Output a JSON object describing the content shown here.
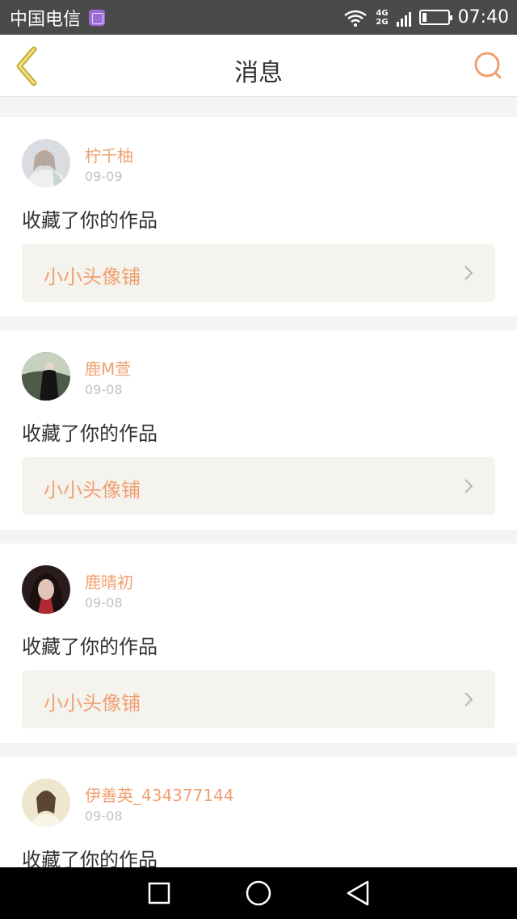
{
  "status_bar": {
    "carrier": "中国电信",
    "network_top": "4G",
    "network_bottom": "2G",
    "time": "07:40",
    "icons": [
      "photo-icon",
      "wifi-icon",
      "signal-icon",
      "battery-icon"
    ]
  },
  "header": {
    "title": "消息",
    "back_icon": "chevron-left-icon",
    "search_icon": "search-icon",
    "accent_color": "#f0a070"
  },
  "messages": [
    {
      "username": "柠千柚",
      "date": "09-09",
      "action": "收藏了你的作品",
      "work": "小小头像铺"
    },
    {
      "username": "鹿M萱",
      "date": "09-08",
      "action": "收藏了你的作品",
      "work": "小小头像铺"
    },
    {
      "username": "鹿晴初",
      "date": "09-08",
      "action": "收藏了你的作品",
      "work": "小小头像铺"
    },
    {
      "username": "伊善英_434377144",
      "date": "09-08",
      "action": "收藏了你的作品",
      "work": ""
    }
  ],
  "nav_bar": {
    "icons": [
      "recent-apps-icon",
      "home-icon",
      "back-icon"
    ]
  }
}
